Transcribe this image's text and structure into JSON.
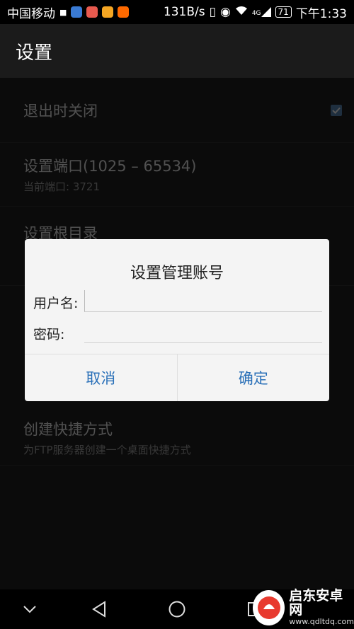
{
  "status_bar": {
    "carrier": "中国移动",
    "speed": "131B/s",
    "signal_label": "4G",
    "battery": "71",
    "time": "下午1:33"
  },
  "header": {
    "title": "设置"
  },
  "settings": {
    "exit_close": {
      "label": "退出时关闭",
      "checked": true
    },
    "port": {
      "label": "设置端口(1025 – 65534)",
      "sub": "当前端口: 3721"
    },
    "root_dir": {
      "label": "设置根目录"
    },
    "shortcut": {
      "label": "创建快捷方式",
      "sub": "为FTP服务器创建一个桌面快捷方式"
    }
  },
  "dialog": {
    "title": "设置管理账号",
    "username_label": "用户名:",
    "username_value": "",
    "password_label": "密码:",
    "password_value": "",
    "cancel_label": "取消",
    "ok_label": "确定"
  },
  "watermark": {
    "brand": "启东安卓网",
    "url": "www.qdltdq.com"
  },
  "colors": {
    "accent": "#2a70b8",
    "checkbox": "#4e7fb0",
    "dialog_bg": "#f4f4f4"
  }
}
